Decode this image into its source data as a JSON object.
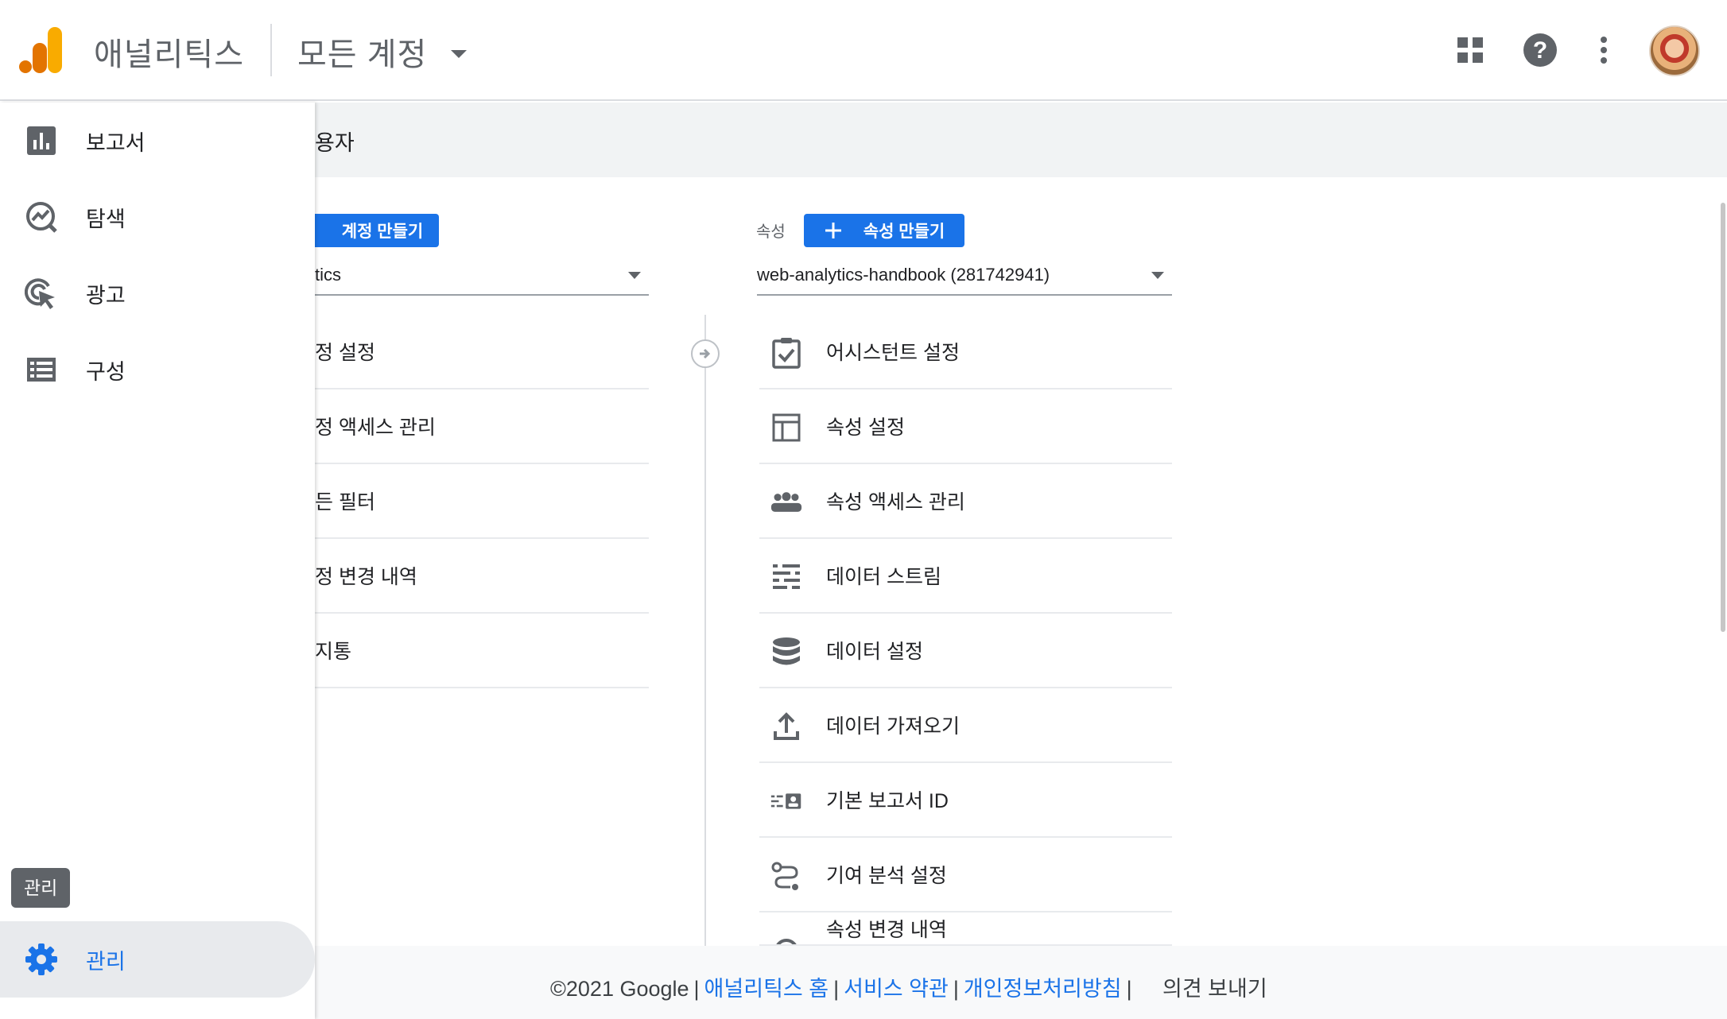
{
  "app": {
    "name": "애널리틱스",
    "account_picker": "모든 계정",
    "brand_colors": {
      "bar1": "#f9ab00",
      "bar2": "#e37400",
      "accent": "#1a73e8"
    }
  },
  "top_icons": [
    "apps-grid-icon",
    "help-icon",
    "more-vert-icon",
    "avatar"
  ],
  "sidebar": {
    "items": [
      {
        "label": "보고서",
        "icon": "bar-chart-icon"
      },
      {
        "label": "탐색",
        "icon": "explore-icon"
      },
      {
        "label": "광고",
        "icon": "ads-cursor-icon"
      },
      {
        "label": "구성",
        "icon": "list-icon"
      }
    ],
    "admin": {
      "label": "관리",
      "icon": "gear-icon"
    },
    "tooltip": "관리"
  },
  "subheader": {
    "title": "용자"
  },
  "account_column": {
    "create_button": "계정 만들기",
    "selected": "tics",
    "rows": [
      "정 설정",
      "정 액세스 관리",
      "든 필터",
      "정 변경 내역",
      "지통"
    ]
  },
  "property_column": {
    "label": "속성",
    "create_button": "속성 만들기",
    "selected": "web-analytics-handbook (281742941)",
    "rows": [
      {
        "label": "어시스턴트 설정",
        "icon": "assistant-checklist-icon"
      },
      {
        "label": "속성 설정",
        "icon": "property-layout-icon"
      },
      {
        "label": "속성 액세스 관리",
        "icon": "people-group-icon"
      },
      {
        "label": "데이터 스트림",
        "icon": "data-streams-icon"
      },
      {
        "label": "데이터 설정",
        "icon": "database-icon"
      },
      {
        "label": "데이터 가져오기",
        "icon": "upload-icon"
      },
      {
        "label": "기본 보고서 ID",
        "icon": "reporting-id-icon"
      },
      {
        "label": "기여 분석 설정",
        "icon": "attribution-path-icon"
      },
      {
        "label": "속성 변경 내역",
        "icon": "history-icon"
      }
    ]
  },
  "footer": {
    "copyright": "©2021 Google",
    "links": [
      "애널리틱스 홈",
      "서비스 약관",
      "개인정보처리방침"
    ],
    "feedback": "의견 보내기"
  }
}
